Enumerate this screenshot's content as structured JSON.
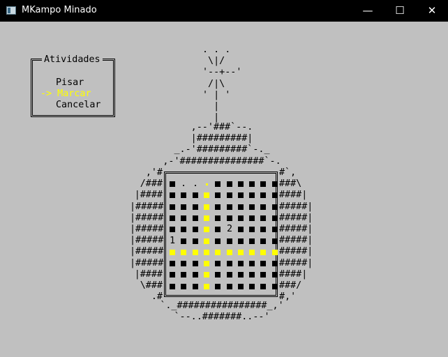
{
  "window": {
    "title": "MKampo Minado",
    "minimize_glyph": "—",
    "maximize_glyph": "☐",
    "close_glyph": "✕"
  },
  "menu": {
    "title": "Atividades",
    "items": [
      {
        "label": "Pisar",
        "active": false
      },
      {
        "label": "-> Marcar",
        "active": true
      },
      {
        "label": "Cancelar",
        "active": false
      }
    ]
  },
  "bomb_art": {
    "fuse": ". . .\n \\|/\n'--+--'\n /|\\\n' | '\n  |\n  |",
    "cap": ",--'###`--.\n|#########|\n_.-'#########`-._\n,-'###############`-.",
    "left_side": ",'#\n/###\n|####\n|#####\n|#####\n|#####\n|#####\n|#####\n|#####\n|####\n\\###\n.#",
    "right_side": "#`,\n###\\\n####|\n#####|\n#####|\n#####|\n#####|\n#####|\n#####|\n####|\n###/\n#,'",
    "bottom": "`._################_,'\n`--..#######..--'"
  },
  "board": {
    "rows": [
      [
        "hidden",
        "empty",
        "empty",
        "cursor",
        "hidden",
        "hidden",
        "hidden",
        "hidden",
        "hidden",
        "hidden"
      ],
      [
        "hidden",
        "hidden",
        "hidden",
        "marked",
        "hidden",
        "hidden",
        "hidden",
        "hidden",
        "hidden",
        "hidden"
      ],
      [
        "hidden",
        "hidden",
        "hidden",
        "marked",
        "hidden",
        "hidden",
        "hidden",
        "hidden",
        "hidden",
        "hidden"
      ],
      [
        "hidden",
        "hidden",
        "hidden",
        "marked",
        "hidden",
        "hidden",
        "hidden",
        "hidden",
        "hidden",
        "hidden"
      ],
      [
        "hidden",
        "hidden",
        "hidden",
        "marked",
        "hidden",
        "2",
        "hidden",
        "hidden",
        "hidden",
        "hidden"
      ],
      [
        "1",
        "hidden",
        "hidden",
        "marked",
        "hidden",
        "hidden",
        "hidden",
        "hidden",
        "hidden",
        "hidden"
      ],
      [
        "marked",
        "marked",
        "marked",
        "marked",
        "marked",
        "marked",
        "marked",
        "marked",
        "marked",
        "marked"
      ],
      [
        "hidden",
        "hidden",
        "hidden",
        "marked",
        "hidden",
        "hidden",
        "hidden",
        "hidden",
        "hidden",
        "hidden"
      ],
      [
        "hidden",
        "hidden",
        "hidden",
        "marked",
        "hidden",
        "hidden",
        "hidden",
        "hidden",
        "hidden",
        "hidden"
      ],
      [
        "hidden",
        "hidden",
        "hidden",
        "marked",
        "hidden",
        "hidden",
        "hidden",
        "hidden",
        "hidden",
        "hidden"
      ]
    ],
    "empty_dot": "."
  },
  "colors": {
    "background": "#c0c0c0",
    "titlebar": "#000000",
    "highlight": "#ffff00",
    "text": "#000000"
  }
}
